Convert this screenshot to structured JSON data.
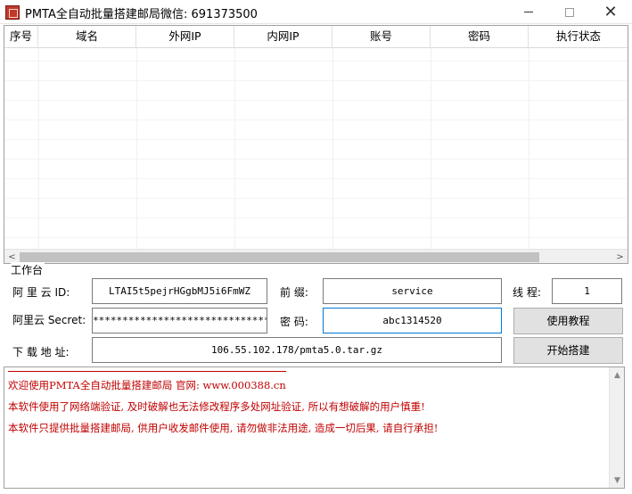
{
  "window": {
    "title": "PMTA全自动批量搭建邮局",
    "wechat": "微信: 691373500",
    "icons": {
      "app": "app-logo-icon",
      "minimize": "minimize-icon",
      "maximize": "maximize-icon",
      "close": "close-icon"
    }
  },
  "grid": {
    "columns": [
      "序号",
      "域名",
      "外网IP",
      "内网IP",
      "账号",
      "密码",
      "执行状态"
    ],
    "rows": []
  },
  "workbench": {
    "group_label": "工作台",
    "aliyun_id_label": "阿 里 云 ID:",
    "aliyun_id_value": "LTAI5t5pejrHGgbMJ5i6FmWZ",
    "prefix_label": "前 缀:",
    "prefix_value": "service",
    "threads_label": "线 程:",
    "threads_value": "1",
    "aliyun_secret_label": "阿里云 Secret:",
    "aliyun_secret_value": "******************************",
    "password_label": "密 码:",
    "password_value": "abc1314520",
    "tutorial_button": "使用教程",
    "download_label": "下 载 地 址:",
    "download_value": "106.55.102.178/pmta5.0.tar.gz",
    "start_button": "开始搭建"
  },
  "log": {
    "lines": [
      "欢迎使用PMTA全自动批量搭建邮局 官网: www.000388.cn",
      "本软件使用了网络端验证, 及时破解也无法修改程序多处网址验证, 所以有想破解的用户慎重!",
      "本软件只提供批量搭建邮局, 供用户收发邮件使用, 请勿做非法用途, 造成一切后果, 请自行承担!"
    ],
    "accent_color": "#c00000"
  }
}
